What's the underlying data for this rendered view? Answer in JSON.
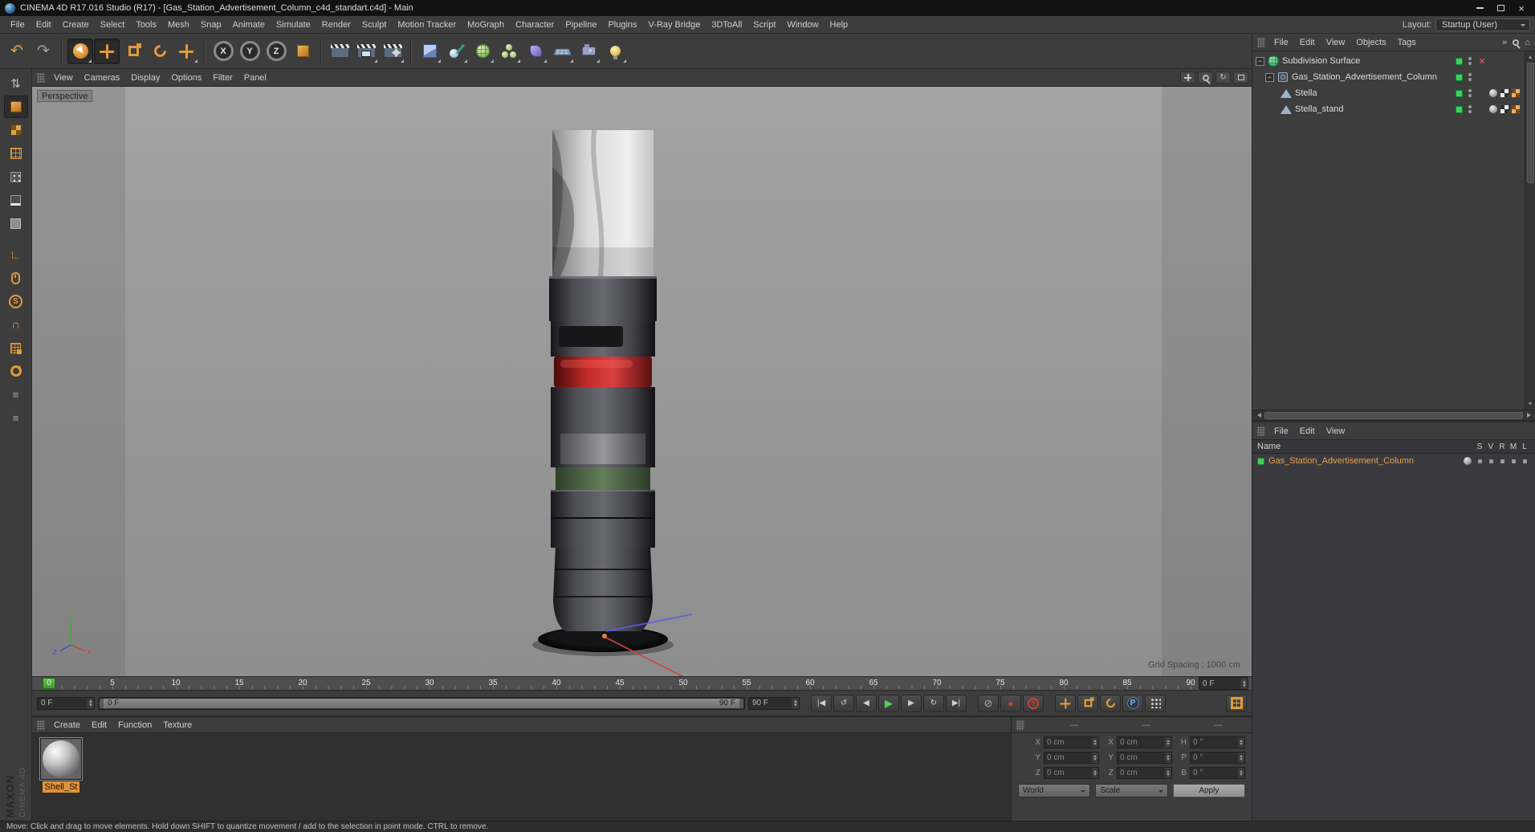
{
  "window": {
    "title": "CINEMA 4D R17.016 Studio (R17) - [Gas_Station_Advertisement_Column_c4d_standart.c4d] - Main"
  },
  "menubar": {
    "items": [
      "File",
      "Edit",
      "Create",
      "Select",
      "Tools",
      "Mesh",
      "Snap",
      "Animate",
      "Simulate",
      "Render",
      "Sculpt",
      "Motion Tracker",
      "MoGraph",
      "Character",
      "Pipeline",
      "Plugins",
      "V-Ray Bridge",
      "3DToAll",
      "Script",
      "Window",
      "Help"
    ],
    "layout_label": "Layout:",
    "layout_value": "Startup (User)"
  },
  "toolbar": {
    "axis_x": "X",
    "axis_y": "Y",
    "axis_z": "Z"
  },
  "viewport": {
    "menu": [
      "View",
      "Cameras",
      "Display",
      "Options",
      "Filter",
      "Panel"
    ],
    "camera_label": "Perspective",
    "grid_spacing_label": "Grid Spacing : 1000 cm",
    "axis_x": "X",
    "axis_y": "Y",
    "axis_z": "Z"
  },
  "timeline": {
    "ticks": [
      "0",
      "5",
      "10",
      "15",
      "20",
      "25",
      "30",
      "35",
      "40",
      "45",
      "50",
      "55",
      "60",
      "65",
      "70",
      "75",
      "80",
      "85",
      "90"
    ],
    "current_frame": "0 F",
    "range_min": "0 F",
    "range_max": "90 F",
    "bar_start_label": "0 F",
    "bar_end_label": "90 F"
  },
  "object_manager": {
    "menu": [
      "File",
      "Edit",
      "View",
      "Objects",
      "Tags"
    ],
    "rows": [
      {
        "label": "Subdivision Surface"
      },
      {
        "label": "Gas_Station_Advertisement_Column"
      },
      {
        "label": "Stella"
      },
      {
        "label": "Stella_stand"
      }
    ]
  },
  "layer_manager": {
    "menu": [
      "File",
      "Edit",
      "View"
    ],
    "name_header": "Name",
    "columns": [
      "S",
      "V",
      "R",
      "M",
      "L"
    ],
    "layer_name": "Gas_Station_Advertisement_Column"
  },
  "material_manager": {
    "menu": [
      "Create",
      "Edit",
      "Function",
      "Texture"
    ],
    "material_name": "Shell_St"
  },
  "coordinates": {
    "headers": [
      "—",
      "—",
      "—"
    ],
    "labels": {
      "px": "X",
      "py": "Y",
      "pz": "Z",
      "sx": "X",
      "sy": "Y",
      "sz": "Z",
      "rh": "H",
      "rp": "P",
      "rb": "B"
    },
    "values": {
      "px": "0 cm",
      "py": "0 cm",
      "pz": "0 cm",
      "sx": "0 cm",
      "sy": "0 cm",
      "sz": "0 cm",
      "rh": "0 °",
      "rp": "0 °",
      "rb": "0 °"
    },
    "world": "World",
    "scale": "Scale",
    "apply": "Apply"
  },
  "status_bar": {
    "text": "Move: Click and drag to move elements. Hold down SHIFT to quantize movement / add to the selection in point mode. CTRL to remove."
  },
  "branding": {
    "line1": "MAXON",
    "line2": "CINEMA 4D"
  },
  "icons": {
    "undo": "↶",
    "redo": "↷",
    "more_menus": "»",
    "home": "⌂",
    "goto_start": "|◀",
    "play_backwards": "↺",
    "prev_frame": "◀",
    "play": "▶",
    "next_frame": "▶",
    "play_mode": "↻",
    "goto_end": "▶|",
    "keyframe_selection": "⊘",
    "record": "●",
    "autokey": "?",
    "make_editable": "⇅",
    "enable_axis": "∟",
    "snap": "∩",
    "solo": "S",
    "parameter": "P",
    "expander_open": "−",
    "red_x": "×"
  }
}
